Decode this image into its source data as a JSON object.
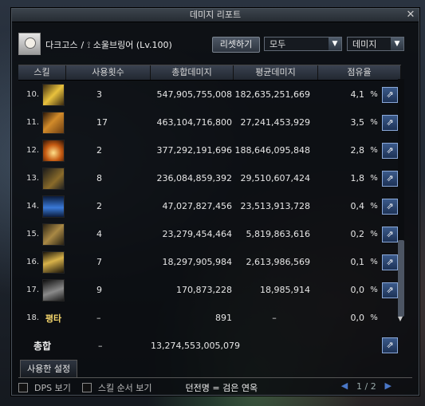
{
  "window": {
    "title": "데미지 리포트"
  },
  "header": {
    "character_name": "다크고스",
    "separator": "/",
    "class_label": "소울브링어 (Lv.100)",
    "reset_label": "리셋하기",
    "filter_value": "모두",
    "type_value": "데미지"
  },
  "table": {
    "columns": [
      "스킬",
      "사용횟수",
      "총합데미지",
      "평균데미지",
      "점유율"
    ],
    "rows": [
      {
        "num": "10.",
        "icon": "gold-skill-icon",
        "count": "3",
        "total": "547,905,755,008",
        "avg": "182,635,251,669",
        "share": "4,1",
        "pct": "%"
      },
      {
        "num": "11.",
        "icon": "orange-skill-icon",
        "count": "17",
        "total": "463,104,716,800",
        "avg": "27,241,453,929",
        "share": "3,5",
        "pct": "%"
      },
      {
        "num": "12.",
        "icon": "flame-skill-icon",
        "count": "2",
        "total": "377,292,191,696",
        "avg": "188,646,095,848",
        "share": "2,8",
        "pct": "%"
      },
      {
        "num": "13.",
        "icon": "dark-skill-icon",
        "count": "8",
        "total": "236,084,859,392",
        "avg": "29,510,607,424",
        "share": "1,8",
        "pct": "%"
      },
      {
        "num": "14.",
        "icon": "blue-skill-icon",
        "count": "2",
        "total": "47,027,827,456",
        "avg": "23,513,913,728",
        "share": "0,4",
        "pct": "%"
      },
      {
        "num": "15.",
        "icon": "rock-skill-icon",
        "count": "4",
        "total": "23,279,454,464",
        "avg": "5,819,863,616",
        "share": "0,2",
        "pct": "%"
      },
      {
        "num": "16.",
        "icon": "slash-skill-icon",
        "count": "7",
        "total": "18,297,905,984",
        "avg": "2,613,986,569",
        "share": "0,1",
        "pct": "%"
      },
      {
        "num": "17.",
        "icon": "gray-skill-icon",
        "count": "9",
        "total": "170,873,228",
        "avg": "18,985,914",
        "share": "0,0",
        "pct": "%"
      },
      {
        "num": "18.",
        "name": "평타",
        "count": "–",
        "total": "891",
        "avg": "–",
        "share": "0,0",
        "pct": "%"
      }
    ],
    "total": {
      "label": "총합",
      "count": "–",
      "total": "13,274,553,005,079"
    }
  },
  "tab": {
    "label": "사용한 설정"
  },
  "footer": {
    "dps_label": "DPS 보기",
    "order_label": "스킬 순서 보기",
    "dungeon_text": "던전명 = 검은 연옥",
    "page": "1 / 2"
  }
}
